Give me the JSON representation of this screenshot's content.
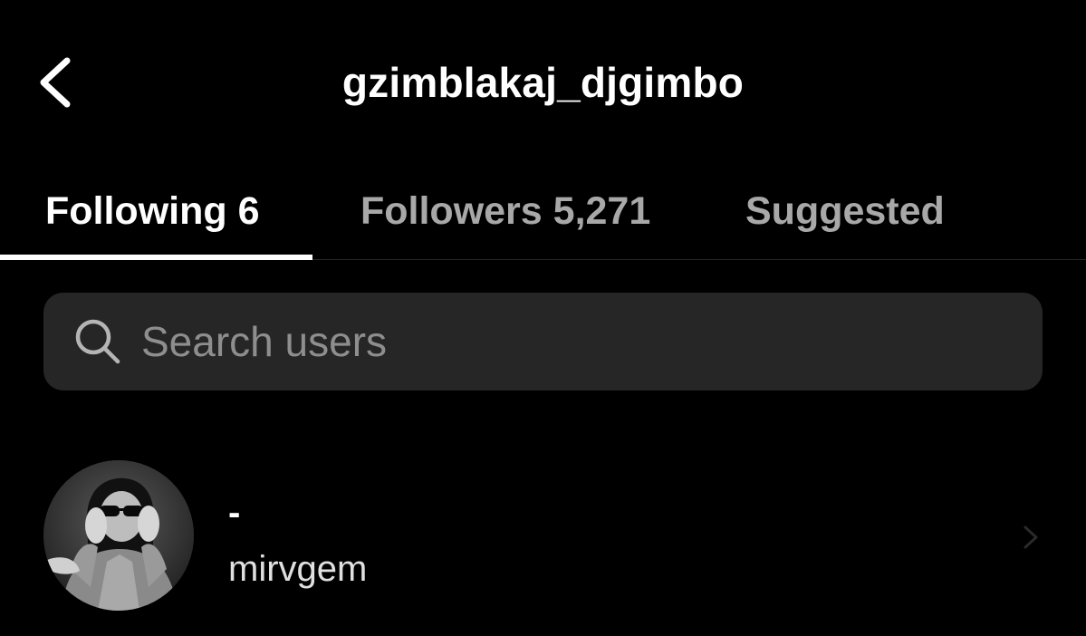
{
  "header": {
    "title": "gzimblakaj_djgimbo",
    "back_icon": "chevron-left-icon"
  },
  "tabs": [
    {
      "label": "Following 6",
      "active": true
    },
    {
      "label": "Followers 5,271",
      "active": false
    },
    {
      "label": "Suggested",
      "active": false
    }
  ],
  "search": {
    "placeholder": "Search users",
    "value": "",
    "icon": "search-icon"
  },
  "users": [
    {
      "display_name": "-",
      "username": "mirvgem",
      "avatar": "avatar-photo",
      "trailing_icon": "chevron-right-icon"
    }
  ],
  "colors": {
    "background": "#000000",
    "text_primary": "#ffffff",
    "text_secondary": "#a8a8a8",
    "search_bg": "#262626",
    "placeholder": "#8e8e8e"
  }
}
